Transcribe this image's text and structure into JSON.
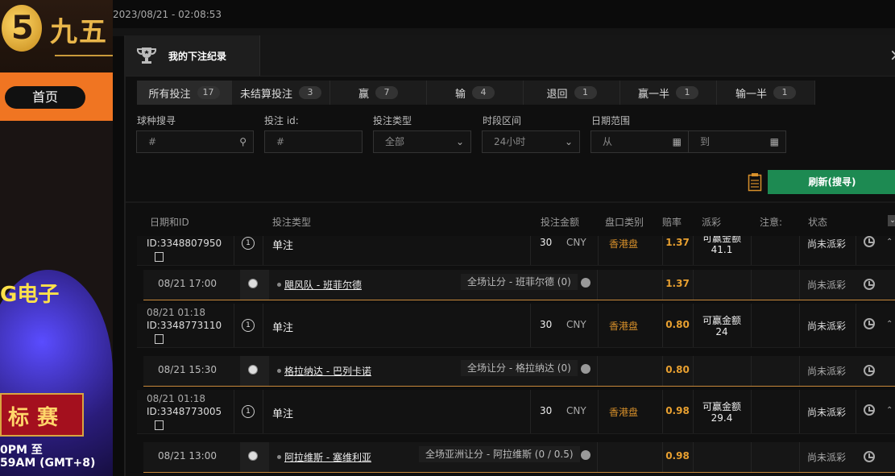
{
  "site": {
    "logo_char": "5",
    "logo_text": "九五",
    "home_label": "首页",
    "datetime": "2023/08/21 - 02:08:53",
    "promo_title": "G电子",
    "promo_banner": "标赛",
    "promo_line1": "0PM 至",
    "promo_line2": "59AM (GMT+8)"
  },
  "modal": {
    "title": "我的下注纪录",
    "close": "×"
  },
  "tabs": [
    {
      "label": "所有投注",
      "count": "17"
    },
    {
      "label": "未结算投注",
      "count": "3"
    },
    {
      "label": "赢",
      "count": "7"
    },
    {
      "label": "输",
      "count": "4"
    },
    {
      "label": "退回",
      "count": "1"
    },
    {
      "label": "赢一半",
      "count": "1"
    },
    {
      "label": "输一半",
      "count": "1"
    }
  ],
  "filters": {
    "sport_label": "球种搜寻",
    "sport_placeholder": "#",
    "betid_label": "投注 id:",
    "betid_placeholder": "#",
    "bettype_label": "投注类型",
    "bettype_value": "全部",
    "period_label": "时段区间",
    "period_value": "24小时",
    "daterange_label": "日期范围",
    "from_placeholder": "从",
    "to_placeholder": "到",
    "refresh_label": "刷新(搜寻)"
  },
  "columns": {
    "date_id": "日期和ID",
    "bet_type": "投注类型",
    "amount": "投注金额",
    "market": "盘口类别",
    "odds": "赔率",
    "payout": "派彩",
    "note": "注意:",
    "status": "状态"
  },
  "bets": [
    {
      "date": "",
      "id_prefix": "ID:",
      "id": "3348807950",
      "num": "1",
      "type": "单注",
      "amount": "30",
      "currency": "CNY",
      "market": "香港盘",
      "odds": "1.37",
      "payout_label": "可赢金额",
      "payout_value": "41.1",
      "status": "尚未派彩",
      "match": {
        "time": "08/21 17:00",
        "teams": "飓风队 - 班菲尔德",
        "market": "全场让分 - 班菲尔德 (0)",
        "odds": "1.37",
        "status": "尚未派彩"
      }
    },
    {
      "date": "08/21 01:18",
      "id_prefix": "ID:",
      "id": "3348773110",
      "num": "1",
      "type": "单注",
      "amount": "30",
      "currency": "CNY",
      "market": "香港盘",
      "odds": "0.80",
      "payout_label": "可赢金额",
      "payout_value": "24",
      "status": "尚未派彩",
      "match": {
        "time": "08/21 15:30",
        "teams": "格拉纳达 - 巴列卡诺",
        "market": "全场让分 - 格拉纳达 (0)",
        "odds": "0.80",
        "status": "尚未派彩"
      }
    },
    {
      "date": "08/21 01:18",
      "id_prefix": "ID:",
      "id": "3348773005",
      "num": "1",
      "type": "单注",
      "amount": "30",
      "currency": "CNY",
      "market": "香港盘",
      "odds": "0.98",
      "payout_label": "可赢金额",
      "payout_value": "29.4",
      "status": "尚未派彩",
      "match": {
        "time": "08/21 13:00",
        "teams": "阿拉维斯 - 塞维利亚",
        "market": "全场亚洲让分 - 阿拉维斯 (0 / 0.5)",
        "odds": "0.98",
        "status": "尚未派彩"
      }
    }
  ],
  "colors": {
    "accent_orange": "#e8a030",
    "market_orange": "#d8902a",
    "refresh_green": "#1d8a52",
    "nav_orange": "#f07522"
  },
  "icons": {
    "trophy": "trophy-icon",
    "search": "search-icon",
    "chevron": "chevron-down-icon",
    "calendar": "calendar-icon",
    "clipboard": "clipboard-icon",
    "copy": "copy-icon",
    "soccer": "soccer-ball-icon",
    "clock": "clock-icon",
    "info": "info-icon"
  }
}
